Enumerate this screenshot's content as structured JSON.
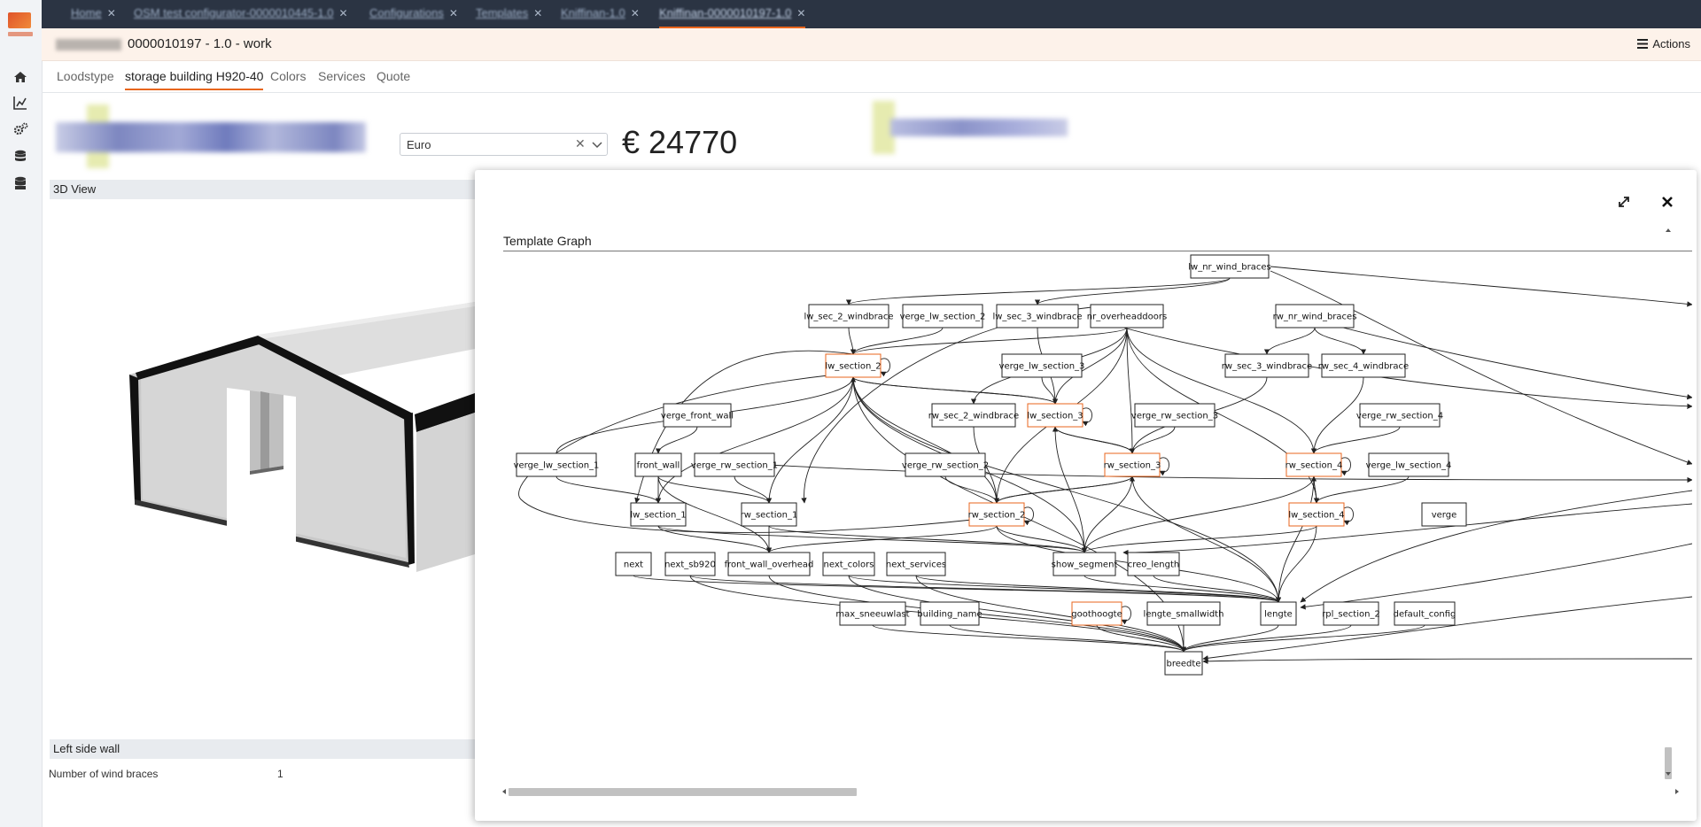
{
  "top_tabs": [
    {
      "label": "Home",
      "active": false
    },
    {
      "label": "OSM test configurator-0000010445-1.0",
      "active": false
    },
    {
      "label": "Configurations",
      "active": false
    },
    {
      "label": "Templates",
      "active": false
    },
    {
      "label": "Kniffinan-1.0",
      "active": false
    },
    {
      "label": "Kniffinan-0000010197-1.0",
      "active": true
    }
  ],
  "title": {
    "text": "0000010197 - 1.0 - work",
    "actions_label": "Actions"
  },
  "sub_tabs": [
    {
      "label": "Loodstype",
      "active": false
    },
    {
      "label": "storage building H920-40",
      "active": true
    },
    {
      "label": "Colors",
      "active": false
    },
    {
      "label": "Services",
      "active": false
    },
    {
      "label": "Quote",
      "active": false
    }
  ],
  "currency": {
    "value": "Euro"
  },
  "price": "€ 24770",
  "panel": {
    "view3d_label": "3D View",
    "left_wall_label": "Left side wall",
    "wind_braces_label": "Number of wind braces",
    "wind_braces_value": "1"
  },
  "graph": {
    "title": "Template Graph",
    "nodes": {
      "lw_nr_wind_braces": "lw_nr_wind_braces",
      "lw_sec_2_windbrace": "lw_sec_2_windbrace",
      "verge_lw_section_2": "verge_lw_section_2",
      "lw_sec_3_windbrace": "lw_sec_3_windbrace",
      "nr_overheaddoors": "nr_overheaddoors",
      "rw_nr_wind_braces": "rw_nr_wind_braces",
      "lw_section_2": "lw_section_2",
      "verge_lw_section_3": "verge_lw_section_3",
      "rw_sec_3_windbrace": "rw_sec_3_windbrace",
      "rw_sec_4_windbrace": "rw_sec_4_windbrace",
      "verge_front_wall": "verge_front_wall",
      "rw_sec_2_windbrace": "rw_sec_2_windbrace",
      "lw_section_3": "lw_section_3",
      "verge_rw_section_3": "verge_rw_section_3",
      "verge_rw_section_4": "verge_rw_section_4",
      "verge_lw_section_1": "verge_lw_section_1",
      "front_wall": "front_wall",
      "verge_rw_section_1": "verge_rw_section_1",
      "verge_rw_section_2": "verge_rw_section_2",
      "rw_section_3": "rw_section_3",
      "rw_section_4": "rw_section_4",
      "verge_lw_section_4": "verge_lw_section_4",
      "lw_section_1": "lw_section_1",
      "rw_section_1": "rw_section_1",
      "rw_section_2": "rw_section_2",
      "lw_section_4": "lw_section_4",
      "verge_partial": "verge",
      "next": "next",
      "next_sb920": "next_sb920",
      "front_wall_overhead": "front_wall_overhead",
      "next_colors": "next_colors",
      "next_services": "next_services",
      "show_segment": "show_segment",
      "creo_length": "creo_length",
      "max_sneeuwlast": "max_sneeuwlast",
      "building_name": "building_name",
      "goothoogte": "goothoogte",
      "lengte_smallwidth": "lengte_smallwidth",
      "lengte": "lengte",
      "rpl_section_2": "rpl_section_2",
      "default_config": "default_config",
      "breedte": "breedte"
    }
  },
  "colors": {
    "accent": "#e8651d",
    "tabbar": "#2b3443",
    "title_bg": "#fdf2ea"
  }
}
